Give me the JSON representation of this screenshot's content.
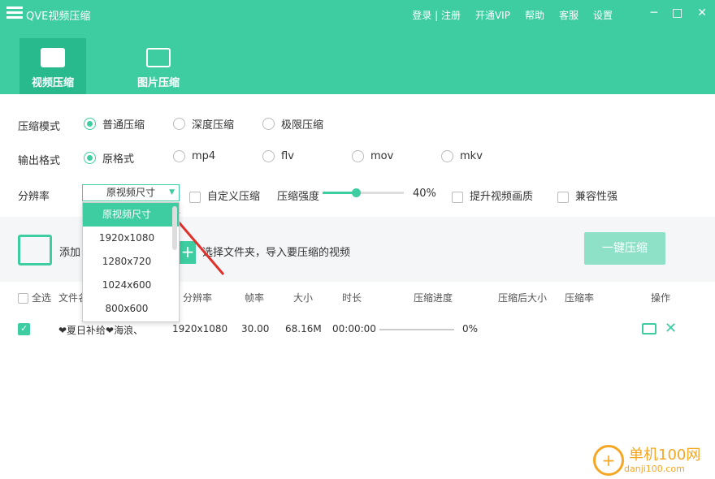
{
  "app": {
    "title": "QVE视频压缩"
  },
  "top_links": [
    "登录 | 注册",
    "开通VIP",
    "帮助",
    "客服",
    "设置"
  ],
  "window_buttons": [
    "─",
    "□",
    "✕"
  ],
  "tabs": [
    {
      "label": "视频压缩",
      "active": true
    },
    {
      "label": "图片压缩",
      "active": false
    }
  ],
  "compress_mode": {
    "label": "压缩模式",
    "options": [
      "普通压缩",
      "深度压缩",
      "极限压缩"
    ],
    "selected": "普通压缩"
  },
  "output_format": {
    "label": "输出格式",
    "options": [
      "原格式",
      "mp4",
      "flv",
      "mov",
      "mkv"
    ],
    "selected": "原格式"
  },
  "resolution": {
    "label": "分辨率",
    "value": "原视频尺寸",
    "options": [
      "原视频尺寸",
      "1920x1080",
      "1280x720",
      "1024x600",
      "800x600"
    ]
  },
  "options": {
    "custom_compress": "自定义压缩",
    "strength_label": "压缩强度",
    "strength_value": "40%",
    "strength_level": 0.4,
    "improve_quality": "提升视频画质",
    "compatibility": "兼容性强"
  },
  "add_area": {
    "add_text": "添加",
    "hint": "选择文件夹，导入要压缩的视频",
    "one_key_button": "一键压缩"
  },
  "table": {
    "headers": [
      "全选",
      "文件名",
      "分辨率",
      "帧率",
      "大小",
      "时长",
      "压缩进度",
      "压缩后大小",
      "压缩率",
      "操作"
    ],
    "rows": [
      {
        "checked": true,
        "filename": "❤夏日补给❤海浪、",
        "resolution": "1920x1080",
        "fps": "30.00",
        "size": "68.16M",
        "duration": "00:00:00",
        "progress_text": "0%",
        "progress": 0
      }
    ]
  },
  "watermark": {
    "name": "单机100网",
    "url": "danji100.com"
  },
  "colors": {
    "accent": "#3dcda0",
    "accent_dark": "#28b98d",
    "arrow": "#e0302b"
  }
}
